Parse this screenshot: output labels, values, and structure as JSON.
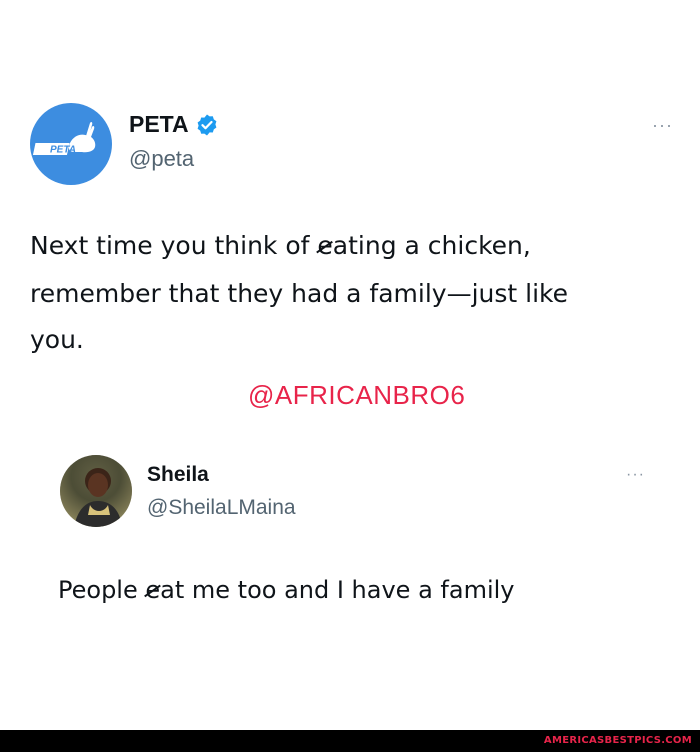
{
  "tweet1": {
    "display_name": "PETA",
    "handle": "@peta",
    "avatar_label": "PETA",
    "more_label": "···",
    "text_line1_pre": "Next time you think of ",
    "text_line1_e": "e",
    "text_line1_post": "ating a chicken,",
    "text_line2": "remember that they had a family—just like",
    "text_line3": "you."
  },
  "watermark": "@AFRICANBRO6",
  "tweet2": {
    "display_name": "Sheila",
    "handle": "@SheilaLMaina",
    "more_label": "···",
    "text_pre": "People ",
    "text_e": "e",
    "text_post": "at me too and I have a family"
  },
  "footer": {
    "site": "AMERICASBESTPICS.COM"
  },
  "colors": {
    "verified_blue": "#1d9bf0",
    "peta_blue": "#3d8de0",
    "watermark_red": "#e8244a"
  }
}
